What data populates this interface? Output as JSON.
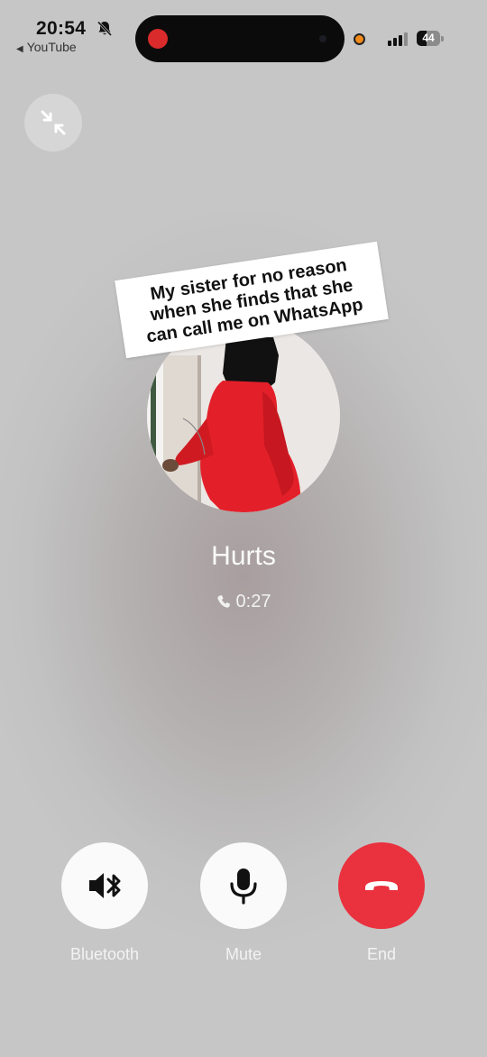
{
  "status_bar": {
    "time": "20:54",
    "back_app": "YouTube",
    "battery_level": "44",
    "battery_fraction": 0.44,
    "icons": [
      "bell-slash-icon",
      "screen-record-icon",
      "camera-in-use-icon",
      "cellular-signal-icon",
      "battery-icon"
    ]
  },
  "call": {
    "contact_name": "Hurts",
    "duration": "0:27",
    "minimize_icon": "minimize-icon",
    "avatar_caption": [
      "My sister for no reason",
      "when she finds that she",
      "can call me on WhatsApp"
    ]
  },
  "controls": {
    "bluetooth_label": "Bluetooth",
    "mute_label": "Mute",
    "end_label": "End"
  },
  "colors": {
    "end_button": "#ea313e",
    "button_bg": "#fafafa",
    "recording_dot": "#d92b2b",
    "camera_indicator": "#f08a1a"
  }
}
